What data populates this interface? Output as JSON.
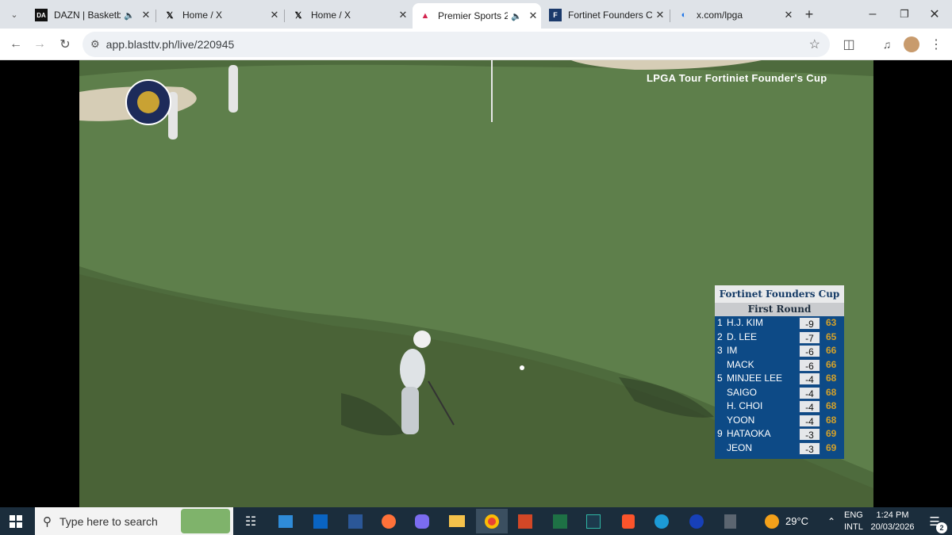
{
  "browser": {
    "tabs": [
      {
        "title": "DAZN | Basketbal",
        "icon": "dazn-icon",
        "audio": true,
        "active": false
      },
      {
        "title": "Home / X",
        "icon": "x-logo-icon",
        "audio": false,
        "active": false
      },
      {
        "title": "Home / X",
        "icon": "x-logo-icon",
        "audio": false,
        "active": false
      },
      {
        "title": "Premier Sports 2",
        "icon": "blasttv-icon",
        "audio": true,
        "active": true
      },
      {
        "title": "Fortinet Founders Cu",
        "icon": "fortinet-icon",
        "audio": false,
        "active": false
      },
      {
        "title": "x.com/lpga",
        "icon": "loading-icon",
        "audio": false,
        "active": false
      }
    ],
    "url": "app.blasttv.ph/live/220945"
  },
  "broadcast": {
    "title": "LPGA Tour Fortiniet Founder's Cup",
    "channel_logo": "PREMIER SPORTS 2"
  },
  "leaderboard": {
    "title": "Fortinet Founders Cup",
    "round": "First Round",
    "rows": [
      {
        "pos": "1",
        "name": "H.J. KIM",
        "par": "-9",
        "score": "63"
      },
      {
        "pos": "2",
        "name": "D. LEE",
        "par": "-7",
        "score": "65"
      },
      {
        "pos": "3",
        "name": "IM",
        "par": "-6",
        "score": "66"
      },
      {
        "pos": "",
        "name": "MACK",
        "par": "-6",
        "score": "66"
      },
      {
        "pos": "5",
        "name": "MINJEE LEE",
        "par": "-4",
        "score": "68"
      },
      {
        "pos": "",
        "name": "SAIGO",
        "par": "-4",
        "score": "68"
      },
      {
        "pos": "",
        "name": "H. CHOI",
        "par": "-4",
        "score": "68"
      },
      {
        "pos": "",
        "name": "YOON",
        "par": "-4",
        "score": "68"
      },
      {
        "pos": "9",
        "name": "HATAOKA",
        "par": "-3",
        "score": "69"
      },
      {
        "pos": "",
        "name": "JEON",
        "par": "-3",
        "score": "69"
      }
    ]
  },
  "taskbar": {
    "search_placeholder": "Type here to search",
    "weather": "29°C",
    "lang1": "ENG",
    "lang2": "INTL",
    "time": "1:24 PM",
    "date": "20/03/2026",
    "notifications": "2"
  }
}
